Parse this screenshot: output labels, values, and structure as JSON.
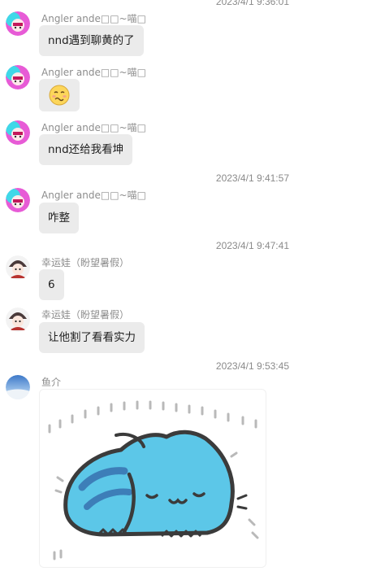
{
  "messages": [
    {
      "type": "timestamp",
      "text": "2023/4/1 9:36:01"
    },
    {
      "type": "text",
      "sender": "Angler ande□□~喵□",
      "text": "nnd遇到聊黄的了",
      "avatar": "pink-anime-avatar"
    },
    {
      "type": "emoji",
      "sender": "Angler ande□□~喵□",
      "emoji": "woozy-face-emoji",
      "avatar": "pink-anime-avatar"
    },
    {
      "type": "text",
      "sender": "Angler ande□□~喵□",
      "text": "nnd还给我看坤",
      "avatar": "pink-anime-avatar"
    },
    {
      "type": "timestamp",
      "text": "2023/4/1 9:41:57"
    },
    {
      "type": "text",
      "sender": "Angler ande□□~喵□",
      "text": "咋整",
      "avatar": "pink-anime-avatar"
    },
    {
      "type": "timestamp",
      "text": "2023/4/1 9:47:41"
    },
    {
      "type": "text",
      "sender": "幸运娃（盼望暑假）",
      "text": "6",
      "avatar": "dark-anime-avatar"
    },
    {
      "type": "text",
      "sender": "幸运娃（盼望暑假）",
      "text": "让他割了看看实力",
      "avatar": "dark-anime-avatar"
    },
    {
      "type": "timestamp",
      "text": "2023/4/1 9:53:45"
    },
    {
      "type": "image",
      "sender": "鱼介",
      "image": "blue-cat-sticker",
      "avatar": "sky-avatar"
    }
  ]
}
